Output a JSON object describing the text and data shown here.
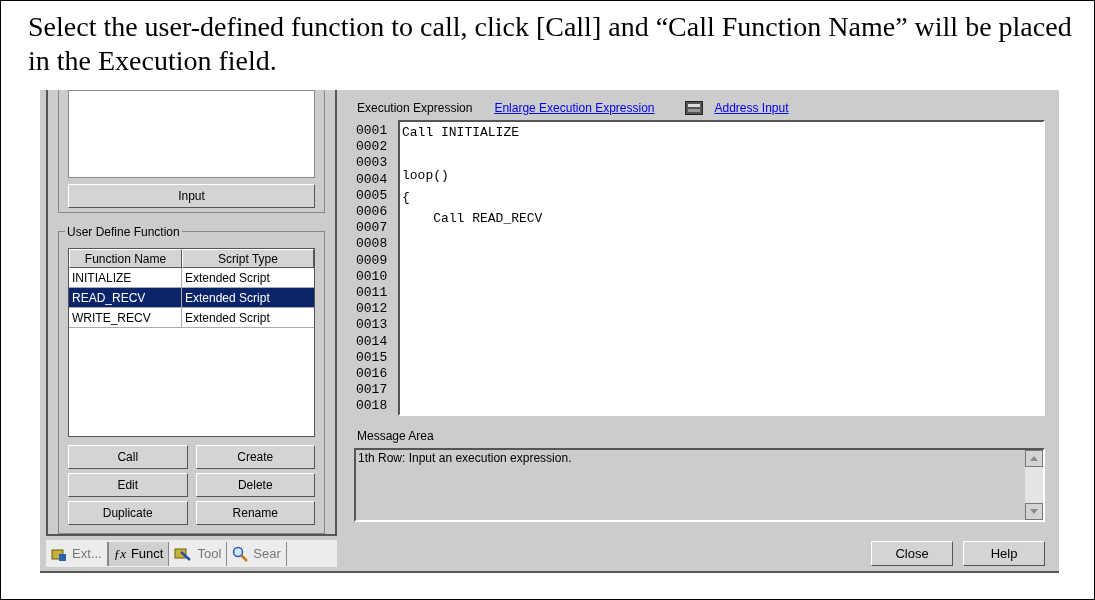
{
  "caption": "Select the user-defined function to call, click [Call] and “Call Function Name” will be placed in the Execution field.",
  "left_panel": {
    "input_button": "Input",
    "group_title": "User Define Function",
    "table": {
      "columns": [
        "Function Name",
        "Script Type"
      ],
      "rows": [
        {
          "cells": [
            "INITIALIZE",
            "Extended Script"
          ],
          "selected": false
        },
        {
          "cells": [
            "READ_RECV",
            "Extended Script"
          ],
          "selected": true
        },
        {
          "cells": [
            "WRITE_RECV",
            "Extended Script"
          ],
          "selected": false
        }
      ]
    },
    "buttons": [
      "Call",
      "Create",
      "Edit",
      "Delete",
      "Duplicate",
      "Rename"
    ],
    "tabs": [
      {
        "label": "Ext...",
        "kind": "script",
        "selected": false
      },
      {
        "label": "Funct",
        "kind": "function",
        "glyph": "ƒx",
        "selected": true
      },
      {
        "label": "Tool",
        "kind": "tool",
        "selected": false
      },
      {
        "label": "Sear",
        "kind": "search",
        "selected": false
      }
    ]
  },
  "editor": {
    "label": "Execution Expression",
    "enlarge_link": "Enlarge Execution Expression",
    "address_link": "Address Input",
    "line_numbers": [
      "0001",
      "0002",
      "0003",
      "0004",
      "0005",
      "0006",
      "0007",
      "0008",
      "0009",
      "0010",
      "0011",
      "0012",
      "0013",
      "0014",
      "0015",
      "0016",
      "0017",
      "0018"
    ],
    "code": "Call INITIALIZE\n\nloop()\n{\n    Call READ_RECV"
  },
  "message_area": {
    "label": "Message Area",
    "text": "1th Row: Input an execution expression."
  },
  "footer_buttons": [
    "Close",
    "Help"
  ]
}
